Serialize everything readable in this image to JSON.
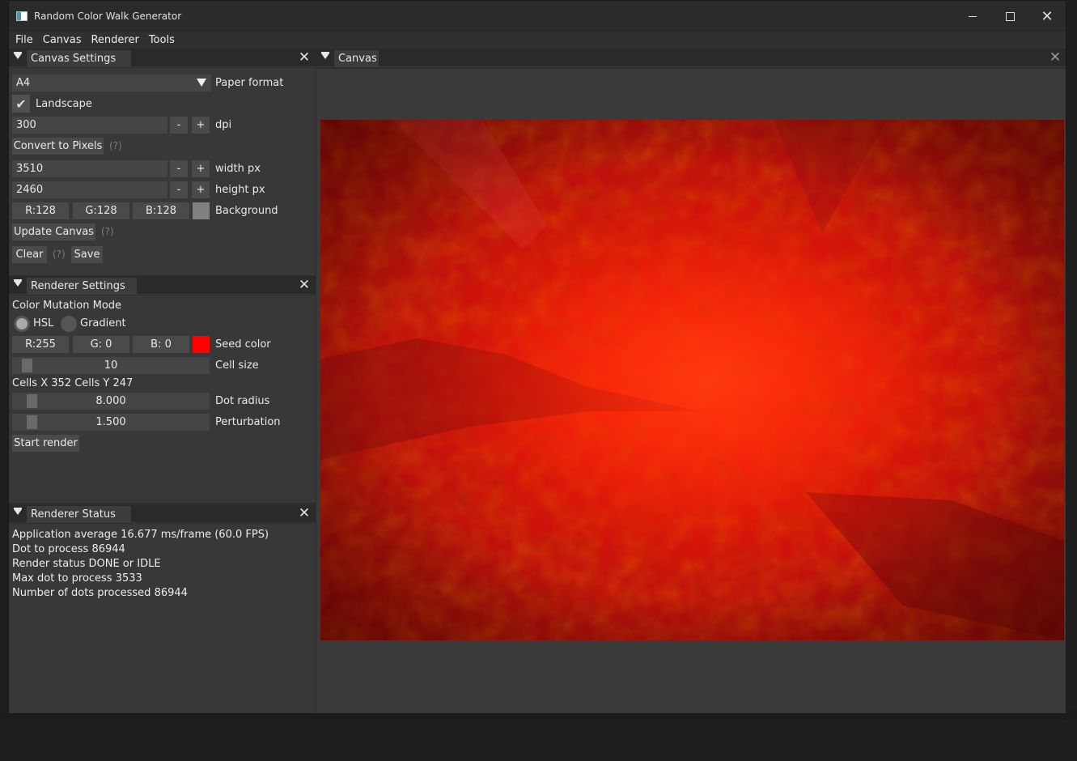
{
  "window": {
    "title": "Random Color Walk Generator"
  },
  "menu": [
    "File",
    "Canvas",
    "Renderer",
    "Tools"
  ],
  "canvas_settings": {
    "tab_label": "Canvas Settings",
    "paper_format_value": "A4",
    "paper_format_label": "Paper format",
    "landscape_label": "Landscape",
    "landscape_checked": true,
    "dpi_value": "300",
    "dpi_label": "dpi",
    "minus": "-",
    "plus": "+",
    "convert_button": "Convert to Pixels",
    "help": "(?)",
    "width_value": "3510",
    "width_label": "width px",
    "height_value": "2460",
    "height_label": "height px",
    "bg_r": "R:128",
    "bg_g": "G:128",
    "bg_b": "B:128",
    "bg_color": "#808080",
    "background_label": "Background",
    "update_button": "Update Canvas",
    "clear_button": "Clear",
    "save_button": "Save"
  },
  "renderer_settings": {
    "tab_label": "Renderer Settings",
    "mode_heading": "Color Mutation Mode",
    "mode_hsl": "HSL",
    "mode_gradient": "Gradient",
    "mode_selected": "HSL",
    "seed_r": "R:255",
    "seed_g": "G:  0",
    "seed_b": "B:  0",
    "seed_color": "#ff0000",
    "seed_label": "Seed color",
    "cell_size_value": "10",
    "cell_size_label": "Cell size",
    "cells_text": "Cells X 352 Cells Y 247",
    "dot_radius_value": "8.000",
    "dot_radius_label": "Dot radius",
    "perturbation_value": "1.500",
    "perturbation_label": "Perturbation",
    "start_button": "Start render"
  },
  "renderer_status": {
    "tab_label": "Renderer Status",
    "lines": [
      "Application average 16.677 ms/frame (60.0 FPS)",
      "Dot to process 86944",
      "Render status DONE or IDLE",
      "Max dot to process 3533",
      "Number of dots processed 86944"
    ]
  },
  "canvas_panel": {
    "tab_label": "Canvas"
  },
  "colors": {
    "accent_red": "#ff0000",
    "panel_bg": "#383838"
  }
}
